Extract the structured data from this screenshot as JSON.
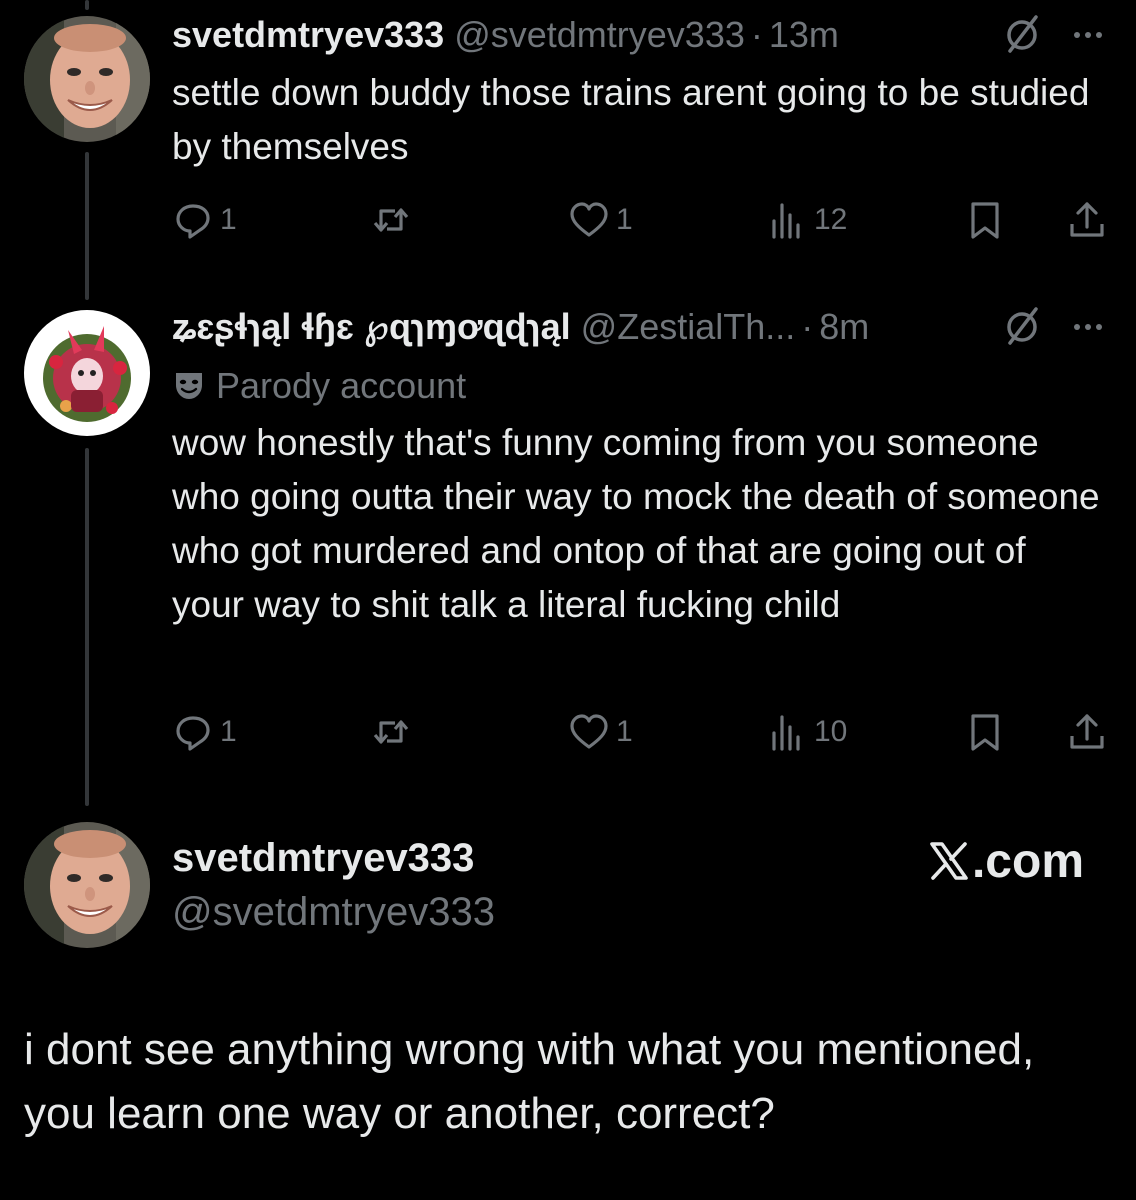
{
  "theme": {
    "background": "#000000",
    "text": "#e7e9ea",
    "muted": "#71767b",
    "thread_line": "#333639"
  },
  "tweets": [
    {
      "display_name": "svetdmtryev333",
      "handle": "@svetdmtryev333",
      "separator": "·",
      "time": "13m",
      "text": "settle down buddy those trains arent going to be studied by themselves",
      "replies": "1",
      "likes": "1",
      "views": "12",
      "avatar_icon": "smiling-man-avatar"
    },
    {
      "display_name": "ʑɛʂɬɿąl ɬɧɛ ℘ɋɿɱơɋɖɿąl",
      "handle": "@ZestialTh...",
      "separator": "·",
      "time": "8m",
      "label": "Parody account",
      "text": "wow honestly that's funny coming from you someone who going outta their way to mock the death of someone who got murdered and ontop of that are going out of your way to shit talk a literal fucking child",
      "replies": "1",
      "likes": "1",
      "views": "10",
      "avatar_icon": "illustrated-character-avatar"
    }
  ],
  "quote_card": {
    "display_name": "svetdmtryev333",
    "handle": "@svetdmtryev333",
    "brand": ".com",
    "brand_icon": "x-logo-icon",
    "text": "i dont see anything wrong with what you mentioned, you learn one way or another, correct?"
  }
}
